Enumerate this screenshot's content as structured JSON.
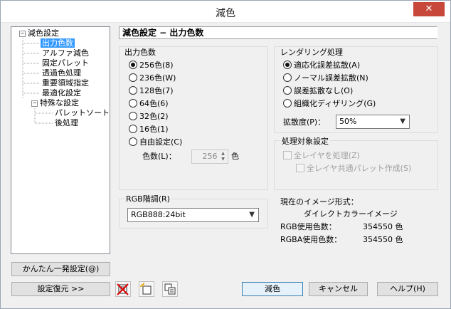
{
  "window": {
    "title": "減色",
    "close_glyph": "✕"
  },
  "tree": {
    "items": [
      {
        "label": "減色設定",
        "expander": "−"
      },
      {
        "label": "出力色数"
      },
      {
        "label": "アルファ減色"
      },
      {
        "label": "固定パレット"
      },
      {
        "label": "透過色処理"
      },
      {
        "label": "重要領域指定"
      },
      {
        "label": "最適化設定"
      },
      {
        "label": "特殊な設定",
        "expander": "−"
      },
      {
        "label": "パレットソート"
      },
      {
        "label": "後処理"
      }
    ]
  },
  "header": {
    "title": "減色設定 − 出力色数"
  },
  "output_colors": {
    "label": "出力色数",
    "options": [
      "256色(8)",
      "236色(W)",
      "128色(7)",
      "64色(6)",
      "32色(2)",
      "16色(1)",
      "自由設定(C)"
    ],
    "count_label": "色数(L)：",
    "count_value": "256",
    "count_unit": "色"
  },
  "rendering": {
    "label": "レンダリング処理",
    "options": [
      "適応化誤差拡散(A)",
      "ノーマル誤差拡散(N)",
      "誤差拡散なし(O)",
      "組織化ディザリング(G)"
    ],
    "diffusion_label": "拡散度(P)：",
    "diffusion_value": "50%",
    "dropdown_arrow": "▼"
  },
  "target": {
    "label": "処理対象設定",
    "layer_process": "全レイヤを処理(Z)",
    "shared_palette": "全レイヤ共通パレット作成(S)"
  },
  "rgb": {
    "label": "RGB階調(R)",
    "value": "RGB888:24bit",
    "dropdown_arrow": "▼"
  },
  "info": {
    "format_label": "現在のイメージ形式：",
    "format_value": "ダイレクトカラーイメージ",
    "rgb_label": "RGB使用色数：",
    "rgb_count": "354550 色",
    "rgba_label": "RGBA使用色数：",
    "rgba_count": "354550 色"
  },
  "buttons": {
    "quick_setup": "かんたん一発設定(@)",
    "restore": "設定復元 >>",
    "reduce": "減色",
    "cancel": "キャンセル",
    "help": "ヘルプ(H)"
  }
}
